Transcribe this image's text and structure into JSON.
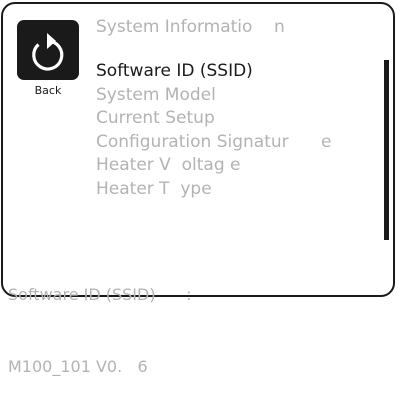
{
  "back": {
    "label": "Back",
    "icon": "back-arrow-icon"
  },
  "title": "System Informatio    n",
  "menu": {
    "items": [
      {
        "label": "Software ID (SSID)",
        "selected": true
      },
      {
        "label": "System Model"
      },
      {
        "label": "Current Setup"
      },
      {
        "label": "Configuration Signatur      e"
      },
      {
        "label": "Heater V  oltag e"
      },
      {
        "label": "Heater T  ype"
      }
    ]
  },
  "detail": {
    "label": "Software ID (SSID)      :",
    "value": "M100_101 V0.   6"
  },
  "colors": {
    "active": "#1a1a1a",
    "inactive": "#b3b3b3",
    "background": "#ffffff"
  }
}
